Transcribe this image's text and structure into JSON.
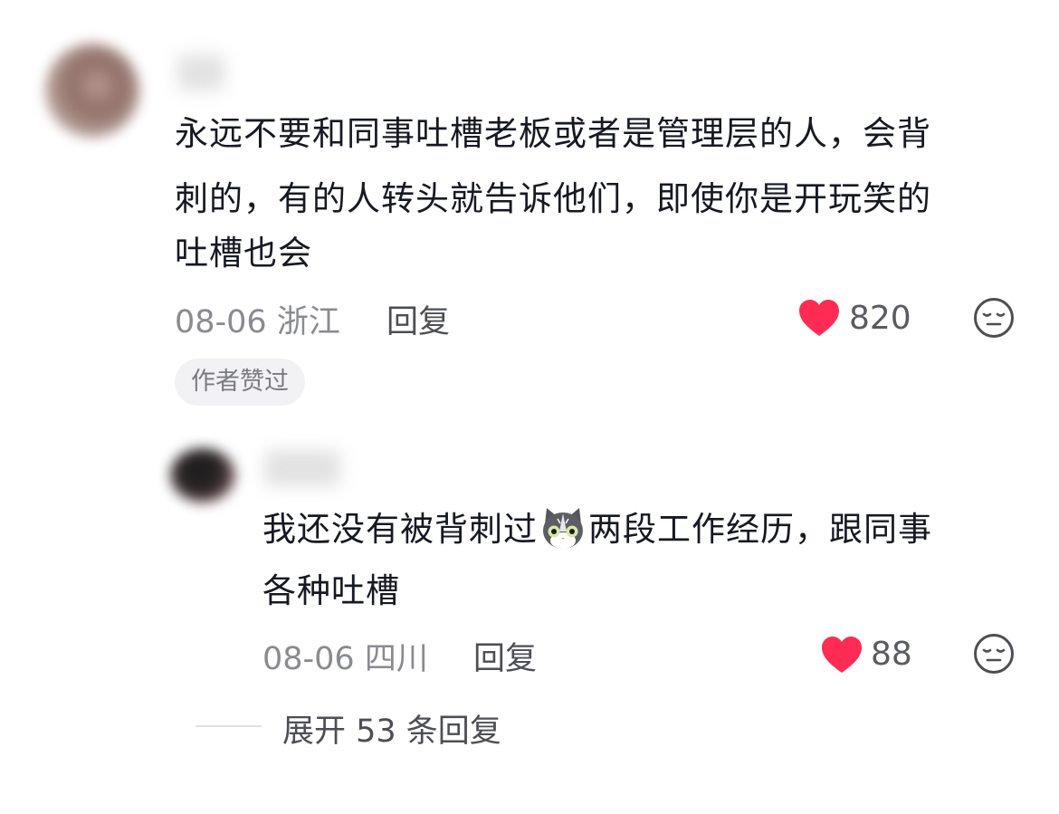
{
  "comment": {
    "text_lines": [
      "永远不要和同事吐槽老板或者是管理层的人，会背",
      "刺的，有的人转头就告诉他们，即使你是开玩笑的",
      "吐槽也会"
    ],
    "date": "08-06",
    "location": "浙江",
    "reply_label": "回复",
    "like_count": "820",
    "badge": "作者赞过"
  },
  "reply": {
    "text_line1_before": "我还没有被背刺过",
    "emoji_icon": "cat-emoji",
    "text_line1_after": "两段工作经历，跟同事",
    "text_line2": "各种吐槽",
    "date": "08-06",
    "location": "四川",
    "reply_label": "回复",
    "like_count": "88"
  },
  "expand": {
    "label": "展开 53 条回复"
  },
  "colors": {
    "heart": "#fe2c55",
    "text": "#161823",
    "meta": "#8a8b91"
  }
}
